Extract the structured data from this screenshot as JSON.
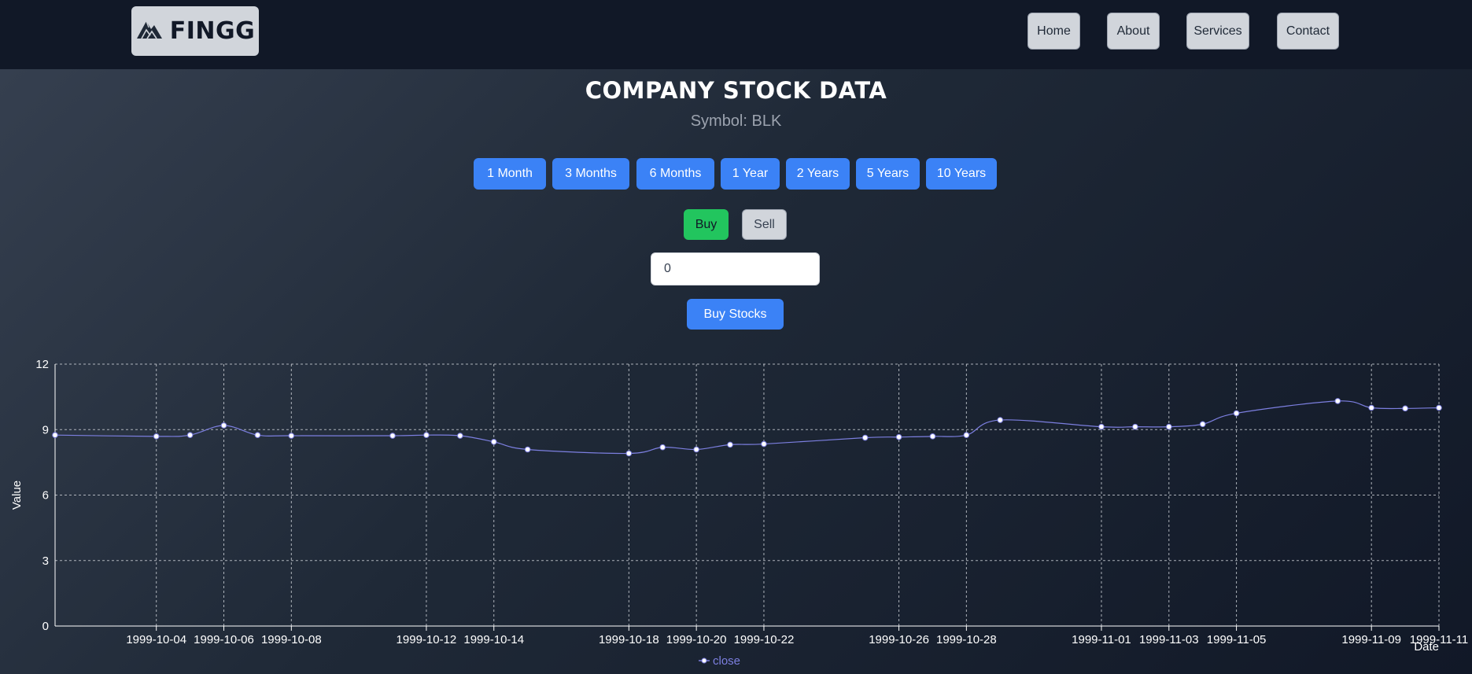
{
  "brand": {
    "name": "FINGG",
    "logo_icon": "mountain-logo-icon"
  },
  "nav": [
    {
      "label": "Home"
    },
    {
      "label": "About"
    },
    {
      "label": "Services"
    },
    {
      "label": "Contact"
    }
  ],
  "page": {
    "title": "COMPANY STOCK DATA",
    "symbol_text": "Symbol: BLK"
  },
  "ranges": [
    "1 Month",
    "3 Months",
    "6 Months",
    "1 Year",
    "2 Years",
    "5 Years",
    "10 Years"
  ],
  "trade": {
    "buy_label": "Buy",
    "sell_label": "Sell",
    "selected": "Buy",
    "quantity_value": "0",
    "submit_label": "Buy Stocks"
  },
  "colors": {
    "accent": "#3b82f6",
    "buy": "#22c55e",
    "line": "#7c7fe0",
    "navbar": "#111827"
  },
  "chart_data": {
    "type": "line",
    "xlabel": "Date",
    "ylabel": "Value",
    "ylim": [
      0,
      12
    ],
    "yticks": [
      0,
      3,
      6,
      9,
      12
    ],
    "grid": true,
    "legend_position": "bottom-center",
    "x_tick_labels": [
      "1999-10-04",
      "1999-10-06",
      "1999-10-08",
      "1999-10-12",
      "1999-10-14",
      "1999-10-18",
      "1999-10-20",
      "1999-10-22",
      "1999-10-26",
      "1999-10-28",
      "1999-11-01",
      "1999-11-03",
      "1999-11-05",
      "1999-11-09",
      "1999-11-11"
    ],
    "series": [
      {
        "name": "close",
        "x": [
          "1999-10-01",
          "1999-10-04",
          "1999-10-05",
          "1999-10-06",
          "1999-10-07",
          "1999-10-08",
          "1999-10-11",
          "1999-10-12",
          "1999-10-13",
          "1999-10-14",
          "1999-10-15",
          "1999-10-18",
          "1999-10-19",
          "1999-10-20",
          "1999-10-21",
          "1999-10-22",
          "1999-10-25",
          "1999-10-26",
          "1999-10-27",
          "1999-10-28",
          "1999-10-29",
          "1999-11-01",
          "1999-11-02",
          "1999-11-03",
          "1999-11-04",
          "1999-11-05",
          "1999-11-08",
          "1999-11-09",
          "1999-11-10",
          "1999-11-11"
        ],
        "values": [
          8.75,
          8.69,
          8.75,
          9.19,
          8.75,
          8.72,
          8.72,
          8.75,
          8.72,
          8.44,
          8.09,
          7.91,
          8.19,
          8.09,
          8.31,
          8.34,
          8.63,
          8.66,
          8.69,
          8.75,
          9.44,
          9.13,
          9.13,
          9.13,
          9.25,
          9.75,
          10.31,
          10.0,
          9.97,
          10.0
        ]
      }
    ]
  }
}
